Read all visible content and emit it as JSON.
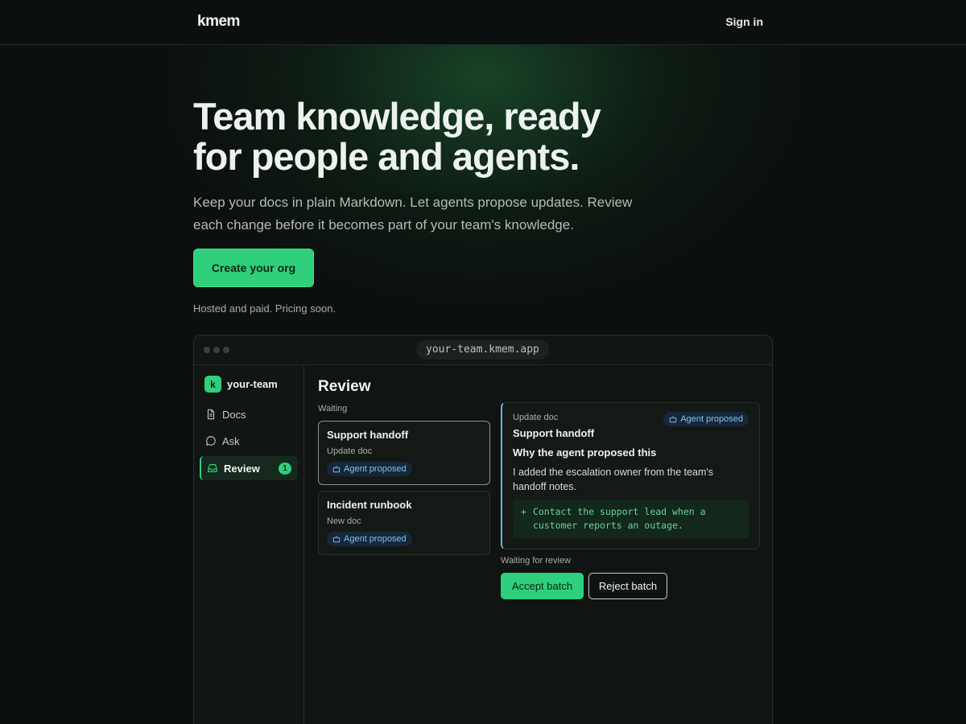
{
  "nav": {
    "logo": "kmem",
    "signin": "Sign in"
  },
  "hero": {
    "title_line1": "Team knowledge, ready",
    "title_line2": "for people and agents.",
    "subtitle_line1": "Keep your docs in plain Markdown. Let agents propose updates. Review",
    "subtitle_line2": "each change before it becomes part of your team's knowledge.",
    "cta": "Create your org",
    "note": "Hosted and paid. Pricing soon."
  },
  "app": {
    "url": "your-team.kmem.app",
    "team_initial": "k",
    "team_name": "your-team",
    "sidebar": [
      {
        "label": "Docs",
        "icon": "doc-icon"
      },
      {
        "label": "Ask",
        "icon": "chat-icon"
      },
      {
        "label": "Review",
        "icon": "inbox-icon",
        "count": "1",
        "active": true
      }
    ],
    "review": {
      "title": "Review",
      "waiting_label": "Waiting",
      "cards": [
        {
          "title": "Support handoff",
          "type": "Update doc",
          "badge": "Agent proposed"
        },
        {
          "title": "Incident runbook",
          "type": "New doc",
          "badge": "Agent proposed"
        }
      ],
      "detail": {
        "type": "Update doc",
        "badge": "Agent proposed",
        "title": "Support handoff",
        "why_heading": "Why the agent proposed this",
        "reason": "I added the escalation owner from the team's handoff notes.",
        "diff_marker": "+",
        "diff_line1": "Contact the support lead when a",
        "diff_line2": "customer reports an outage."
      },
      "status_label": "Waiting for review",
      "accept": "Accept batch",
      "reject": "Reject batch"
    }
  },
  "colors": {
    "accent": "#2fcf7c",
    "background": "#0b0f0d",
    "badge_text": "#7cc4ef"
  }
}
